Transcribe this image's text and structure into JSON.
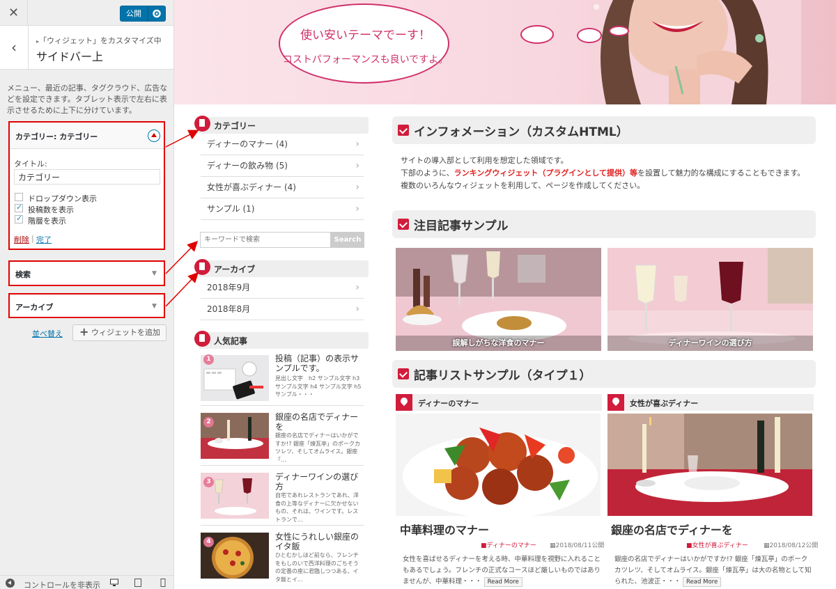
{
  "customizer": {
    "close_icon": "close-icon",
    "publish_label": "公開",
    "breadcrumb": "「ウィジェット」をカスタマイズ中",
    "section_title": "サイドバー上",
    "description": "メニュー、最近の記事、タグクラウド、広告などを設定できます。タブレット表示で左右に表示させるために上下に分けています。",
    "widget_category": {
      "header": "カテゴリー: カテゴリー",
      "title_label": "タイトル:",
      "title_value": "カテゴリー",
      "options": [
        {
          "label": "ドロップダウン表示",
          "checked": false
        },
        {
          "label": "投稿数を表示",
          "checked": true
        },
        {
          "label": "階層を表示",
          "checked": true
        }
      ],
      "delete_label": "削除",
      "separator": "|",
      "done_label": "完了"
    },
    "widget_search": "検索",
    "widget_archive": "アーカイブ",
    "reorder_label": "並べ替え",
    "add_widget_label": "ウィジェットを追加",
    "hide_controls_label": "コントロールを非表示"
  },
  "preview": {
    "banner": {
      "line1": "使い安いテーマでーす！",
      "line2": "コストパフォーマンスも良いですよ。"
    },
    "sidebar": {
      "category_title": "カテゴリー",
      "categories": [
        "ディナーのマナー (4)",
        "ディナーの飲み物 (5)",
        "女性が喜ぶディナー (4)",
        "サンプル (1)"
      ],
      "search_placeholder": "キーワードで検索",
      "search_button": "Search",
      "archive_title": "アーカイブ",
      "archives": [
        "2018年9月",
        "2018年8月"
      ],
      "popular_title": "人気記事",
      "popular": [
        {
          "num": "1",
          "title": "投稿（記事）の表示サンプルです。",
          "excerpt": "見出し文字　h2 サンプル文字 h3 サンプル文字 h4 サンプル文字 h5 サンプル・・・"
        },
        {
          "num": "2",
          "title": "銀座の名店でディナーを",
          "excerpt": "銀座の名店でディナーはいかがですか!? 銀座「煉瓦亭」のポークカツレツ、そしてオムライス。銀座「..."
        },
        {
          "num": "3",
          "title": "ディナーワインの選び方",
          "excerpt": "自宅であれレストランであれ、洋食の上等なディナーに欠かせないもの、それは、ワインです。レストランで..."
        },
        {
          "num": "4",
          "title": "女性にうれしい銀座のイタ飯",
          "excerpt": "ひとむかしほど前なら、フレンチをもしのいで西洋料理のごちそうの定番の座に君臨しつつある、イタ飯とイ..."
        }
      ]
    },
    "main": {
      "info_title": "インフォメーション（カスタムHTML）",
      "info_line1": "サイトの導入部として利用を想定した領域です。",
      "info_line2_pre": "下部のように、",
      "info_line2_hl": "ランキングウィジェット（プラグインとして提供）等",
      "info_line2_post": "を設置して魅力的な構成にすることもできます。複数のいろんなウィジェットを利用して、ページを作成してください。",
      "featured_title": "注目記事サンプル",
      "featured": [
        "誤解しがちな洋食のマナー",
        "ディナーワインの選び方"
      ],
      "list_title": "記事リストサンプル（タイプ１）",
      "posts": [
        {
          "category": "ディナーのマナー",
          "title": "中華料理のマナー",
          "cat_small": "ディナーのマナー",
          "date": "2018/08/11公開",
          "excerpt": "女性を喜ばせるディナーを考える時、中華料理を視野に入れることもあるでしょう。フレンチの正式なコースほど厳しいものではありませんが、中華料理・・・",
          "read_more": "Read More"
        },
        {
          "category": "女性が喜ぶディナー",
          "title": "銀座の名店でディナーを",
          "cat_small": "女性が喜ぶディナー",
          "date": "2018/08/12公開",
          "excerpt": "銀座の名店でディナーはいかがですか!? 銀座「煉瓦亭」のポークカツレツ、そしてオムライス。銀座「煉瓦亭」は大の名物として知られた、池波正・・・",
          "read_more": "Read More"
        }
      ]
    }
  },
  "colors": {
    "accent": "#d11c3c",
    "wp_blue": "#0073aa",
    "highlight_border": "#e00000"
  }
}
